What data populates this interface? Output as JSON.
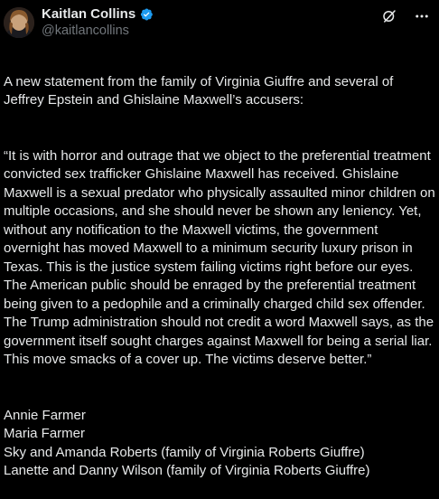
{
  "author": {
    "display_name": "Kaitlan Collins",
    "handle": "@kaitlancollins",
    "verified_color": "#1d9bf0"
  },
  "icons": {
    "verified": "verified-badge-icon",
    "grok": "grok-icon",
    "more": "more-options-icon"
  },
  "tweet": {
    "intro": "A new statement from the family of Virginia Giuffre and several of Jeffrey Epstein and Ghislaine Maxwell’s accusers:",
    "quote": "“It is with horror and outrage that we object to the preferential treatment convicted sex trafficker Ghislaine Maxwell has received. Ghislaine Maxwell is a sexual predator who physically assaulted minor children on multiple occasions, and she should never be shown any leniency. Yet, without any notification to the Maxwell victims, the government overnight has moved Maxwell to a minimum security luxury prison in Texas. This is the justice system failing victims right before our eyes.  The American public should be enraged by the preferential treatment being given to a pedophile and a criminally charged child sex offender. The Trump administration should not credit a word Maxwell says, as the government itself sought charges against Maxwell for being a serial liar. This move smacks of a cover up. The victims deserve better.”",
    "signatories": [
      "Annie Farmer",
      "Maria Farmer",
      "Sky and Amanda Roberts (family of Virginia Roberts Giuffre)",
      "Lanette and Danny Wilson (family of Virginia Roberts Giuffre)"
    ]
  },
  "colors": {
    "background": "#000000",
    "text": "#e7e9ea",
    "secondary_text": "#71767b",
    "accent": "#1d9bf0"
  }
}
